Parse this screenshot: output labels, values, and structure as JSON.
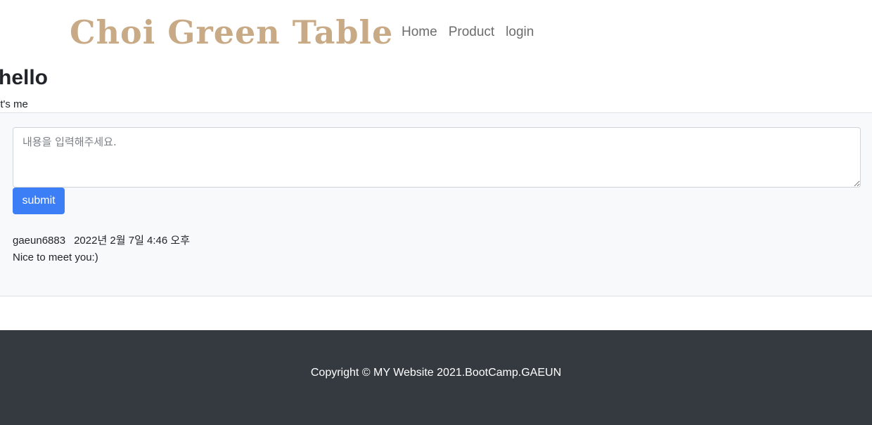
{
  "navbar": {
    "brand": "Choi Green Table",
    "links": [
      {
        "label": "Home"
      },
      {
        "label": "Product"
      },
      {
        "label": "login"
      }
    ]
  },
  "page": {
    "heading": "hello",
    "subheading": "it's me"
  },
  "comment_form": {
    "placeholder": "내용을 입력해주세요.",
    "value": "",
    "submit_label": "submit"
  },
  "comments": [
    {
      "author": "gaeun6883",
      "datetime": "2022년 2월 7일 4:46 오후",
      "text": "Nice to meet you:)"
    }
  ],
  "footer": {
    "copyright": "Copyright © MY Website 2021.BootCamp.GAEUN"
  },
  "colors": {
    "brand": "#c8ab86",
    "primary_button": "#3b7ef6",
    "footer_bg": "#343a40",
    "section_bg": "#f8f9fa"
  }
}
